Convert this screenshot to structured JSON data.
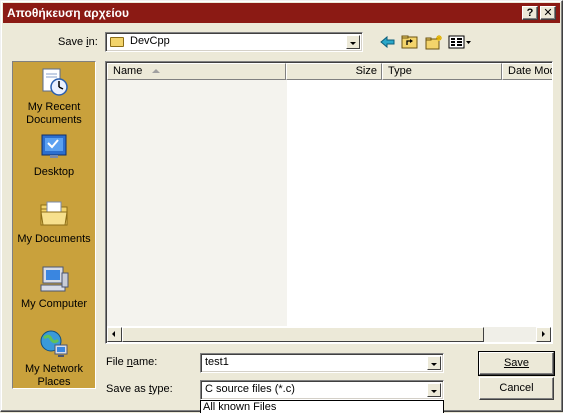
{
  "window": {
    "title": "Αποθήκευση αρχείου",
    "help_glyph": "?",
    "close_glyph": "✕"
  },
  "save_in": {
    "label_pre": "Save ",
    "label_key": "i",
    "label_post": "n:",
    "value": "DevCpp"
  },
  "toolbar": {
    "icons": [
      "back-arrow-icon",
      "up-folder-icon",
      "new-folder-icon",
      "view-menu-icon"
    ]
  },
  "places": [
    {
      "label": "My Recent Documents",
      "icon": "recent-documents-icon"
    },
    {
      "label": "Desktop",
      "icon": "desktop-icon"
    },
    {
      "label": "My Documents",
      "icon": "my-documents-icon"
    },
    {
      "label": "My Computer",
      "icon": "my-computer-icon"
    },
    {
      "label": "My Network Places",
      "icon": "network-places-icon"
    }
  ],
  "file_list": {
    "columns": [
      "Name",
      "Size",
      "Type",
      "Date Mod"
    ],
    "rows": []
  },
  "file_name": {
    "label_pre": "File ",
    "label_key": "n",
    "label_post": "ame:",
    "value": "test1"
  },
  "save_as_type": {
    "label_pre": "Save as ",
    "label_key": "t",
    "label_post": "ype:",
    "value": "C source files (*.c)",
    "dropdown_first_option": "All known Files"
  },
  "buttons": {
    "save": "Save",
    "cancel": "Cancel"
  },
  "colors": {
    "titlebar": "#8b1a14",
    "places_bar": "#c9a13c",
    "face": "#ece9d8"
  }
}
